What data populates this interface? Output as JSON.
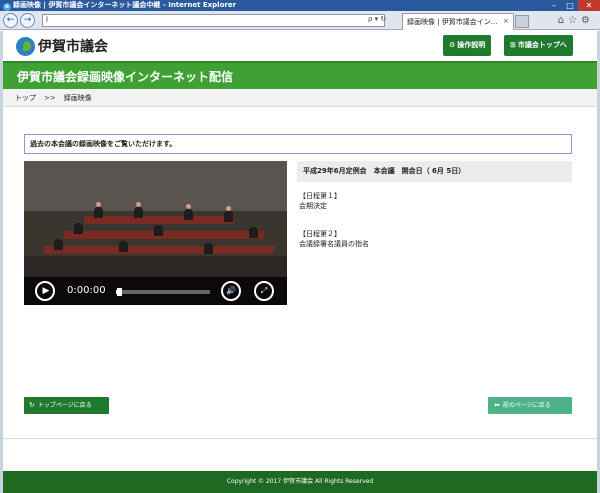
{
  "window": {
    "title": "録画映像 | 伊賀市議会インターネット議会中継 - Internet Explorer",
    "controls": [
      "–",
      "□",
      "✕"
    ]
  },
  "browser": {
    "url": "l",
    "tab_title": "録画映像 | 伊賀市議会イン...",
    "tab_close": "×",
    "url_icons": "ρ ▾ ↻"
  },
  "header": {
    "logo_text": "伊賀市議会",
    "btn_help": "操作説明",
    "btn_top": "市議会トップへ"
  },
  "banner": {
    "title": "伊賀市議会録画映像インターネット配信"
  },
  "breadcrumb": {
    "home": "トップ",
    "separator": ">>",
    "current": "録画映像"
  },
  "notice": {
    "text": "過去の本会議の録画映像をご覧いただけます。"
  },
  "player": {
    "time": "0:00:00",
    "progress": 0.03,
    "play_glyph": "▶",
    "volume_glyph": "🔊",
    "fullscreen_glyph": "⤢"
  },
  "session": {
    "title": "平成29年6月定例会　本会議　開会日（ 6月 5日）"
  },
  "agenda": [
    {
      "heading": "【日程第１】",
      "item": "会期決定"
    },
    {
      "heading": "【日程第２】",
      "item": "会議録署名議員の指名"
    }
  ],
  "nav": {
    "back_top": "トップページに戻る",
    "back_prev": "前のページに戻る"
  },
  "footer": {
    "copyright": "Copyright © 2017 伊賀市議会 All Rights Reserved"
  },
  "colors": {
    "brand_green": "#3fa134",
    "dark_green": "#1f7a2e",
    "accent_teal": "#4fb38a"
  }
}
